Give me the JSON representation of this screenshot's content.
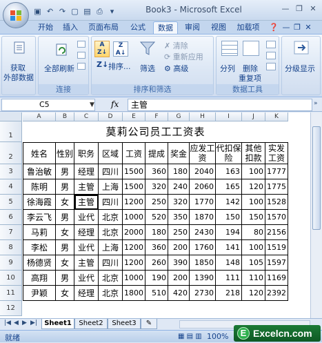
{
  "window": {
    "title": "Book3 - Microsoft Excel",
    "quick_access": [
      "save",
      "undo",
      "redo",
      "new",
      "open",
      "print-preview",
      "customize"
    ]
  },
  "ribbon_tabs": [
    {
      "label": "开始"
    },
    {
      "label": "插入"
    },
    {
      "label": "页面布局"
    },
    {
      "label": "公式"
    },
    {
      "label": "数据",
      "active": true
    },
    {
      "label": "审阅"
    },
    {
      "label": "视图"
    },
    {
      "label": "加载项"
    }
  ],
  "ribbon": {
    "get_external": "获取",
    "get_external_2": "外部数据",
    "refresh_all": "全部刷新",
    "group_connections": "连接",
    "sort_label": "排序...",
    "filter": "筛选",
    "clear": "清除",
    "reapply": "重新应用",
    "advanced": "高级",
    "group_sort_filter": "排序和筛选",
    "split": "分列",
    "remove": "删除",
    "remove_2": "重复项",
    "group_data_tools": "数据工具",
    "outline": "分级显示"
  },
  "formula_bar": {
    "name_box": "C5",
    "fx": "fx",
    "value": "主管"
  },
  "sheet": {
    "columns": [
      "A",
      "B",
      "C",
      "D",
      "E",
      "F",
      "G",
      "H",
      "I",
      "J",
      "K"
    ],
    "rows": [
      "1",
      "2",
      "3",
      "4",
      "5",
      "6",
      "7",
      "8",
      "9",
      "10",
      "11",
      "12"
    ],
    "title": "莫莉公司员工工资表",
    "headers": [
      "姓名",
      "性别",
      "职务",
      "区域",
      "工资",
      "提成",
      "奖金",
      "应发工资",
      "代扣保险",
      "其他扣款",
      "实发工资"
    ],
    "data": [
      [
        "鲁治敏",
        "男",
        "经理",
        "四川",
        "1500",
        "360",
        "180",
        "2040",
        "163",
        "100",
        "1777"
      ],
      [
        "陈明",
        "男",
        "主管",
        "上海",
        "1500",
        "320",
        "240",
        "2060",
        "165",
        "120",
        "1775"
      ],
      [
        "徐海霞",
        "女",
        "主管",
        "四川",
        "1200",
        "250",
        "320",
        "1770",
        "142",
        "100",
        "1528"
      ],
      [
        "李云飞",
        "男",
        "业代",
        "北京",
        "1000",
        "520",
        "350",
        "1870",
        "150",
        "150",
        "1570"
      ],
      [
        "马莉",
        "女",
        "经理",
        "北京",
        "2000",
        "180",
        "250",
        "2430",
        "194",
        "80",
        "2156"
      ],
      [
        "李松",
        "男",
        "业代",
        "上海",
        "1200",
        "360",
        "200",
        "1760",
        "141",
        "100",
        "1519"
      ],
      [
        "杨德贤",
        "女",
        "主管",
        "四川",
        "1200",
        "260",
        "390",
        "1850",
        "148",
        "105",
        "1597"
      ],
      [
        "高翔",
        "男",
        "业代",
        "北京",
        "1000",
        "190",
        "200",
        "1390",
        "111",
        "110",
        "1169"
      ],
      [
        "尹颖",
        "女",
        "经理",
        "北京",
        "1800",
        "510",
        "420",
        "2730",
        "218",
        "120",
        "2392"
      ]
    ]
  },
  "sheet_tabs": [
    "Sheet1",
    "Sheet2",
    "Sheet3"
  ],
  "status": {
    "ready": "就绪",
    "zoom": "100%"
  },
  "watermark": {
    "letter": "E",
    "text": "Excelcn.com"
  },
  "colors": {
    "ribbon_tab_text": "#15428b",
    "accent": "#8db2e3"
  }
}
